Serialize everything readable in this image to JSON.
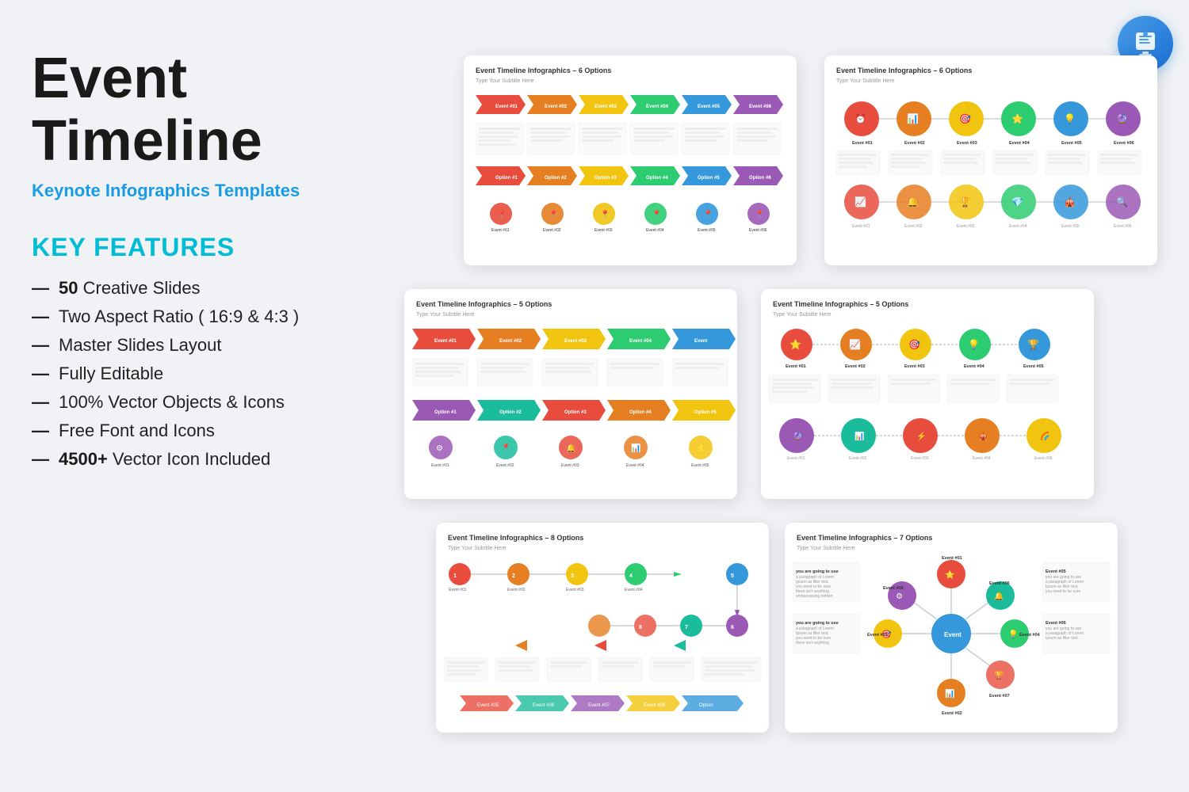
{
  "page": {
    "background": "#eef1f5"
  },
  "header": {
    "main_title": "Event Timeline",
    "subtitle_bold": "Keynote",
    "subtitle_rest": " Infographics Templates"
  },
  "features": {
    "section_title": "KEY FEATURES",
    "items": [
      {
        "bold": "50",
        "rest": " Creative Slides"
      },
      {
        "bold": "",
        "rest": "Two Aspect Ratio ( 16:9 & 4:3 )"
      },
      {
        "bold": "",
        "rest": "Master Slides Layout"
      },
      {
        "bold": "",
        "rest": "Fully Editable"
      },
      {
        "bold": "",
        "rest": "100% Vector Objects & Icons"
      },
      {
        "bold": "",
        "rest": "Free Font and Icons"
      },
      {
        "bold": "4500+",
        "rest": " Vector Icon Included"
      }
    ]
  },
  "slides": [
    {
      "id": "slide-1",
      "title": "Event Timeline Infographics – 6 Options",
      "subtitle": "Type Your Subtitle Here",
      "type": "arrows"
    },
    {
      "id": "slide-2",
      "title": "Event Timeline Infographics – 6 Options",
      "subtitle": "Type Your Subtitle Here",
      "type": "circles"
    },
    {
      "id": "slide-3",
      "title": "Event Timeline Infographics – 5 Options",
      "subtitle": "Type Your Subtitle Here",
      "type": "chevrons"
    },
    {
      "id": "slide-4",
      "title": "Event Timeline Infographics – 5 Options",
      "subtitle": "Type Your Subtitle Here",
      "type": "dots"
    },
    {
      "id": "slide-5",
      "title": "Event Timeline Infographics – 8 Options",
      "subtitle": "Type Your Subtitle Here",
      "type": "zigzag"
    },
    {
      "id": "slide-6",
      "title": "Event Timeline Infographics – 7 Options",
      "subtitle": "Type Your Subtitle Here",
      "type": "flower"
    }
  ],
  "colors": {
    "red": "#e74c3c",
    "orange": "#e67e22",
    "yellow": "#f1c40f",
    "green": "#2ecc71",
    "teal": "#1abc9c",
    "blue": "#3498db",
    "purple": "#9b59b6",
    "cyan": "#00bcd4",
    "accent": "#1a9be6"
  },
  "keynote_icon": {
    "alt": "Keynote Logo"
  }
}
